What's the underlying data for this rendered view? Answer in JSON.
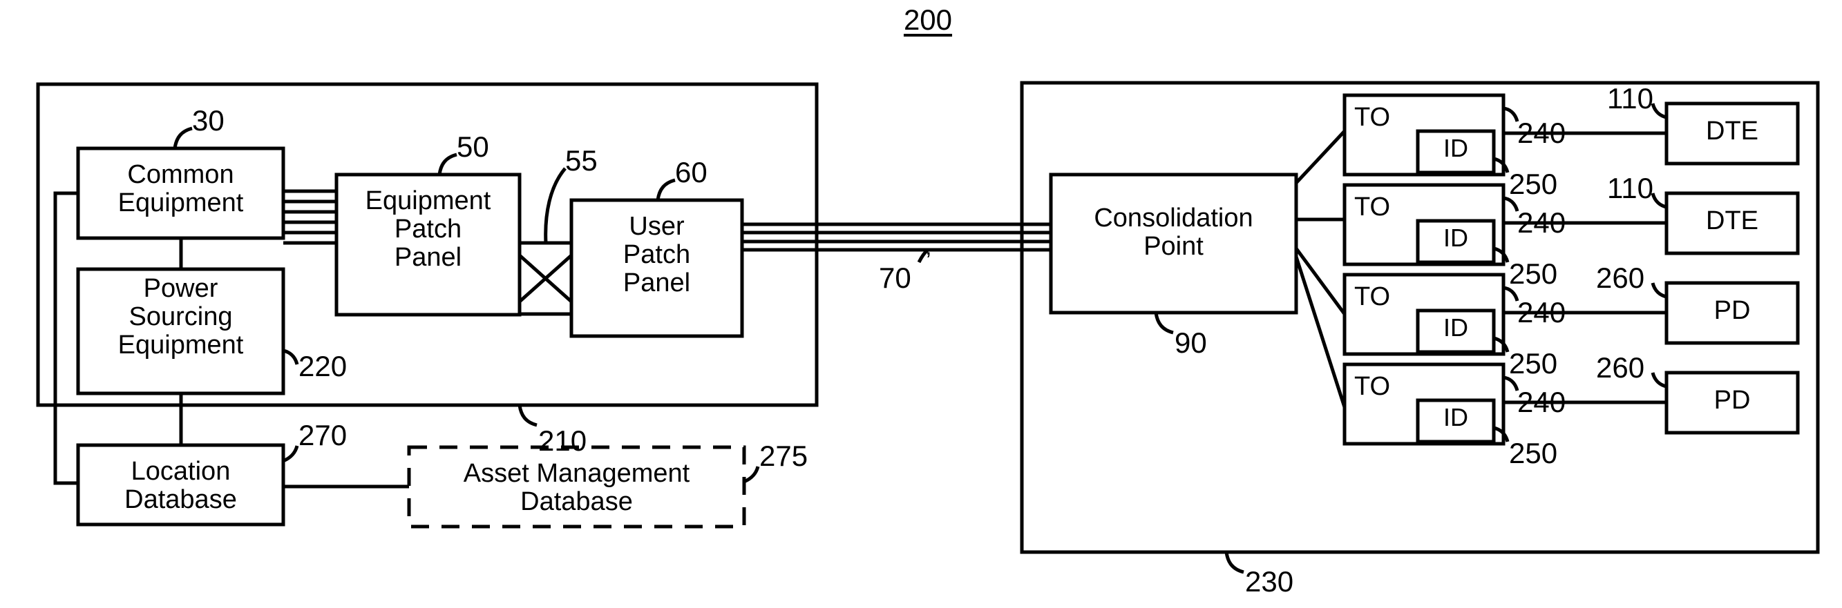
{
  "figure": {
    "number": "200",
    "title_underlined": true
  },
  "colors": {
    "stroke": "#000000",
    "background": "#ffffff"
  },
  "left_enclosure": {
    "name": "telecommunications-room",
    "reference": "210",
    "boxes": [
      {
        "id": "common-equipment",
        "label": "Common\nEquipment",
        "reference": "30"
      },
      {
        "id": "power-sourcing-equipment",
        "label": "Power\nSourcing\nEquipment",
        "reference": "220"
      },
      {
        "id": "equipment-patch-panel",
        "label": "Equipment\nPatch\nPanel",
        "reference": "50"
      },
      {
        "id": "user-patch-panel",
        "label": "User\nPatch\nPanel",
        "reference": "60"
      }
    ],
    "cross_connect": {
      "id": "patch-cords",
      "reference": "55"
    }
  },
  "databases": [
    {
      "id": "location-database",
      "label": "Location\nDatabase",
      "reference": "270",
      "style": "solid"
    },
    {
      "id": "asset-management-database",
      "label": "Asset Management\nDatabase",
      "reference": "275",
      "style": "dashed"
    }
  ],
  "horizontal_cabling": {
    "id": "horizontal-cable",
    "reference": "70",
    "line_count": 4
  },
  "right_enclosure": {
    "name": "work-area",
    "reference": "230",
    "consolidation_point": {
      "label": "Consolidation\nPoint",
      "reference": "90"
    },
    "outlets": [
      {
        "to_label": "TO",
        "id_label": "ID",
        "to_reference": "240",
        "id_reference": "250",
        "device_label": "DTE",
        "device_reference": "110"
      },
      {
        "to_label": "TO",
        "id_label": "ID",
        "to_reference": "240",
        "id_reference": "250",
        "device_label": "DTE",
        "device_reference": "110"
      },
      {
        "to_label": "TO",
        "id_label": "ID",
        "to_reference": "240",
        "id_reference": "250",
        "device_label": "PD",
        "device_reference": "260"
      },
      {
        "to_label": "TO",
        "id_label": "ID",
        "to_reference": "240",
        "id_reference": "250",
        "device_label": "PD",
        "device_reference": "260"
      }
    ]
  }
}
